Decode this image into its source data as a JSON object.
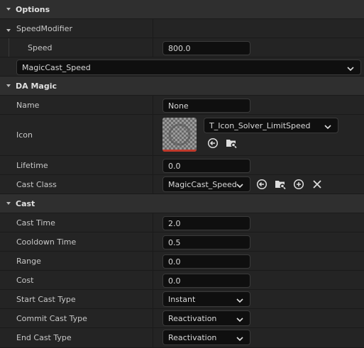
{
  "options": {
    "header": "Options",
    "speed_modifier_label": "SpeedModifier",
    "speed_label": "Speed",
    "speed_value": "800.0",
    "asset_value": "MagicCast_Speed"
  },
  "da_magic": {
    "header": "DA Magic",
    "name_label": "Name",
    "name_value": "None",
    "icon_label": "Icon",
    "icon_texture": "T_Icon_Solver_LimitSpeed",
    "lifetime_label": "Lifetime",
    "lifetime_value": "0.0",
    "cast_class_label": "Cast Class",
    "cast_class_value": "MagicCast_Speed"
  },
  "cast": {
    "header": "Cast",
    "cast_time_label": "Cast Time",
    "cast_time_value": "2.0",
    "cooldown_label": "Cooldown Time",
    "cooldown_value": "0.5",
    "range_label": "Range",
    "range_value": "0.0",
    "cost_label": "Cost",
    "cost_value": "0.0",
    "start_type_label": "Start Cast Type",
    "start_type_value": "Instant",
    "commit_type_label": "Commit Cast Type",
    "commit_type_value": "Reactivation",
    "end_type_label": "End Cast Type",
    "end_type_value": "Reactivation"
  },
  "icons": {
    "collapse": "chevron-down-icon",
    "use_selected": "arrow-left-circle-icon",
    "browse": "folder-search-icon",
    "add": "plus-circle-icon",
    "clear": "close-icon"
  },
  "colors": {
    "panel": "#1e1e1e",
    "header": "#2f2f2f",
    "row": "#242424",
    "field": "#0f0f0f",
    "accent_red": "#c0392b"
  }
}
